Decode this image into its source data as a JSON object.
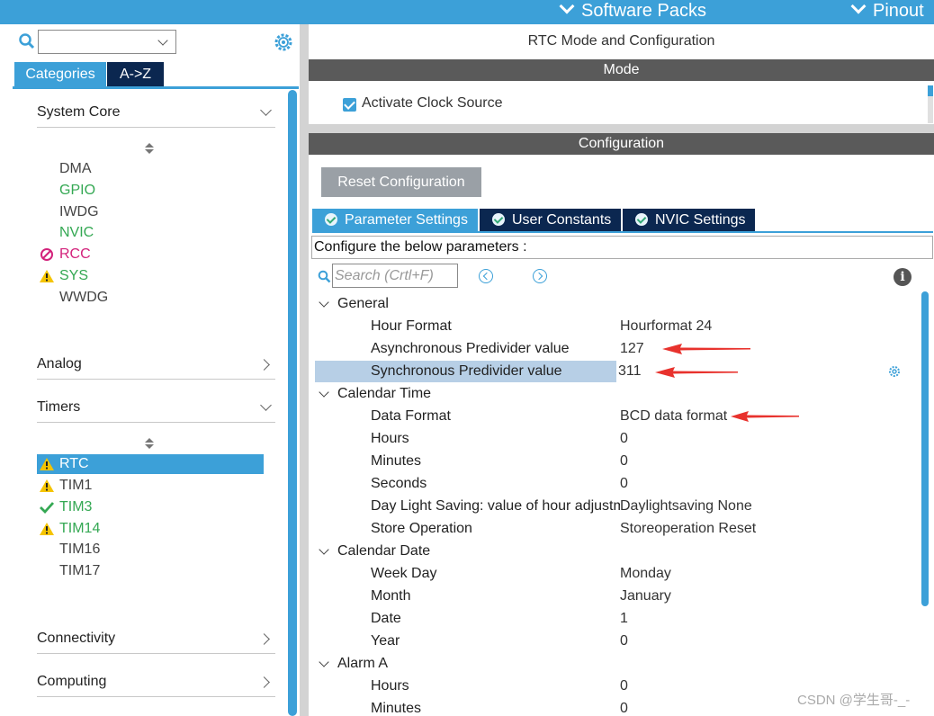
{
  "topbar": {
    "software_packs": "Software Packs",
    "pinout": "Pinout"
  },
  "left": {
    "tabs": {
      "categories": "Categories",
      "atoz": "A->Z"
    },
    "categories": [
      {
        "label": "System Core"
      },
      {
        "label": "Analog"
      },
      {
        "label": "Timers"
      },
      {
        "label": "Connectivity"
      },
      {
        "label": "Computing"
      }
    ],
    "system_core_items": [
      {
        "label": "DMA",
        "status": "none",
        "color": "gray"
      },
      {
        "label": "GPIO",
        "status": "none",
        "color": "green"
      },
      {
        "label": "IWDG",
        "status": "none",
        "color": "gray"
      },
      {
        "label": "NVIC",
        "status": "none",
        "color": "green"
      },
      {
        "label": "RCC",
        "status": "error",
        "color": "pink"
      },
      {
        "label": "SYS",
        "status": "warning",
        "color": "green"
      },
      {
        "label": "WWDG",
        "status": "none",
        "color": "gray"
      }
    ],
    "timer_items": [
      {
        "label": "RTC",
        "status": "warning",
        "selected": true
      },
      {
        "label": "TIM1",
        "status": "warning",
        "color": "gray"
      },
      {
        "label": "TIM3",
        "status": "ok",
        "color": "green"
      },
      {
        "label": "TIM14",
        "status": "warning",
        "color": "green"
      },
      {
        "label": "TIM16",
        "status": "none",
        "color": "gray"
      },
      {
        "label": "TIM17",
        "status": "none",
        "color": "gray"
      }
    ]
  },
  "right": {
    "title": "RTC Mode and Configuration",
    "mode_header": "Mode",
    "activate_clock_source": "Activate Clock Source",
    "config_header": "Configuration",
    "reset_button": "Reset Configuration",
    "tabs": {
      "param": "Parameter Settings",
      "user": "User Constants",
      "nvic": "NVIC Settings"
    },
    "hint": "Configure the below parameters :",
    "search_placeholder": "Search (Crtl+F)",
    "info": "i",
    "groups": {
      "general": "General",
      "calendar_time": "Calendar Time",
      "calendar_date": "Calendar Date",
      "alarm_a": "Alarm A"
    },
    "params": {
      "hour_format": {
        "name": "Hour Format",
        "value": "Hourformat 24"
      },
      "async_prediv": {
        "name": "Asynchronous Predivider value",
        "value": "127"
      },
      "sync_prediv": {
        "name": "Synchronous Predivider value",
        "value": "311"
      },
      "data_format": {
        "name": "Data Format",
        "value": "BCD data format"
      },
      "hours": {
        "name": "Hours",
        "value": "0"
      },
      "minutes": {
        "name": "Minutes",
        "value": "0"
      },
      "seconds": {
        "name": "Seconds",
        "value": "0"
      },
      "daylight": {
        "name": "Day Light Saving: value of hour adjustm...",
        "value": "Daylightsaving None"
      },
      "store_op": {
        "name": "Store Operation",
        "value": "Storeoperation Reset"
      },
      "week_day": {
        "name": "Week Day",
        "value": "Monday"
      },
      "month": {
        "name": "Month",
        "value": "January"
      },
      "date": {
        "name": "Date",
        "value": "1"
      },
      "year": {
        "name": "Year",
        "value": "0"
      },
      "alarm_hours": {
        "name": "Hours",
        "value": "0"
      },
      "alarm_minutes": {
        "name": "Minutes",
        "value": "0"
      }
    }
  },
  "watermark": "CSDN @学生哥-_-",
  "colors": {
    "accent": "#3ca0d8",
    "dark_tab": "#0b2750",
    "header_bar": "#5a5a5a",
    "annotation_arrow": "#e8322d"
  }
}
